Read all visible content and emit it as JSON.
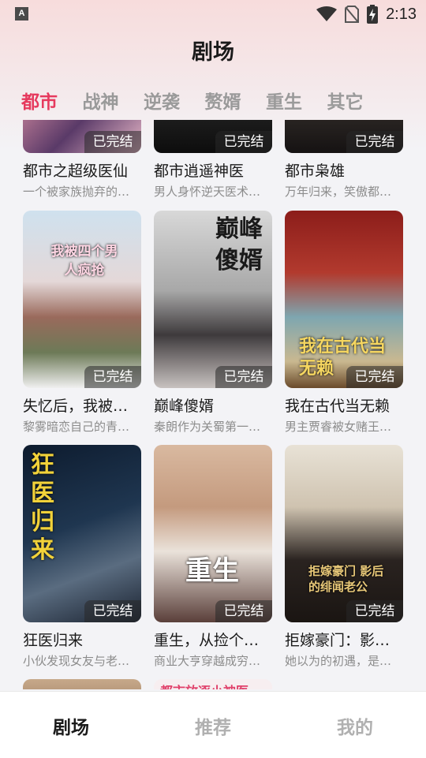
{
  "status_bar": {
    "notification_icon": "A",
    "time": "2:13",
    "icons": [
      "wifi-icon",
      "no-sim-icon",
      "battery-charging-icon"
    ]
  },
  "header": {
    "title": "剧场"
  },
  "tabs": [
    {
      "label": "都市",
      "active": true
    },
    {
      "label": "战神",
      "active": false
    },
    {
      "label": "逆袭",
      "active": false
    },
    {
      "label": "赘婿",
      "active": false
    },
    {
      "label": "重生",
      "active": false
    },
    {
      "label": "其它",
      "active": false
    }
  ],
  "badge_label": "已完结",
  "rows": [
    [
      {
        "title": "都市之超级医仙",
        "desc": "一个被家族抛弃的…"
      },
      {
        "title": "都市逍遥神医",
        "desc": "男人身怀逆天医术…"
      },
      {
        "title": "都市枭雄",
        "desc": "万年归来，笑傲都…"
      }
    ],
    [
      {
        "title": "失忆后，我被…",
        "desc": "黎雾暗恋自己的青…",
        "poster_text": "我被四个男人疯抢"
      },
      {
        "title": "巅峰傻婿",
        "desc": "秦朗作为关蜀第一…",
        "poster_text": "巅峰傻婿"
      },
      {
        "title": "我在古代当无赖",
        "desc": "男主贾睿被女赌王…",
        "poster_text": "我在古代当无赖"
      }
    ],
    [
      {
        "title": "狂医归来",
        "desc": "小伙发现女友与老…",
        "poster_text": "狂医归来"
      },
      {
        "title": "重生，从捡个…",
        "desc": "商业大亨穿越成穷…",
        "poster_text": "重生"
      },
      {
        "title": "拒嫁豪门：影…",
        "desc": "她以为的初遇，是…",
        "poster_text": "拒嫁豪门 影后的绯闻老公"
      }
    ]
  ],
  "partial_row_text": "都市放逐小神医",
  "bottom_nav": [
    {
      "label": "剧场",
      "active": true
    },
    {
      "label": "推荐",
      "active": false
    },
    {
      "label": "我的",
      "active": false
    }
  ]
}
